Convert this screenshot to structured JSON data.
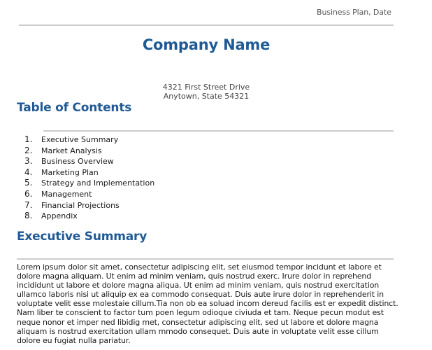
{
  "header": {
    "text": "Business Plan, Date"
  },
  "title": {
    "company": "Company Name",
    "address_line1": "4321 First Street Drive",
    "address_line2": "Anytown, State 54321"
  },
  "toc": {
    "heading": "Table of Contents",
    "items": [
      {
        "num": "1.",
        "label": "Executive Summary"
      },
      {
        "num": "2.",
        "label": "Market Analysis"
      },
      {
        "num": "3.",
        "label": "Business Overview"
      },
      {
        "num": "4.",
        "label": "Marketing Plan"
      },
      {
        "num": "5.",
        "label": "Strategy and Implementation"
      },
      {
        "num": "6.",
        "label": "Management"
      },
      {
        "num": "7.",
        "label": "Financial Projections"
      },
      {
        "num": "8.",
        "label": "Appendix"
      }
    ]
  },
  "executive_summary": {
    "heading": "Executive Summary",
    "body": "Lorem ipsum dolor sit amet, consectetur adipiscing elit, set eiusmod tempor incidunt et labore et dolore magna aliquam. Ut enim ad minim veniam, quis nostrud exerc. Irure dolor in reprehend incididunt ut labore et dolore magna aliqua. Ut enim ad minim veniam, quis nostrud exercitation ullamco laboris nisi ut aliquip ex ea commodo consequat. Duis aute irure dolor in reprehenderit in voluptate velit esse molestaie cillum.Tia non ob ea soluad incom dereud facilis est er expedit distinct. Nam liber te conscient to factor tum poen legum odioque civiuda et tam. Neque pecun modut est neque nonor et imper ned libidig met, consectetur adipiscing elit, sed ut labore et dolore magna aliquam is nostrud exercitation ullam mmodo consequet. Duis aute in voluptate velit esse cillum dolore eu fugiat nulla pariatur."
  },
  "colors": {
    "accent": "#1f5a96",
    "rule": "#cccccc",
    "header_text": "#555555"
  }
}
